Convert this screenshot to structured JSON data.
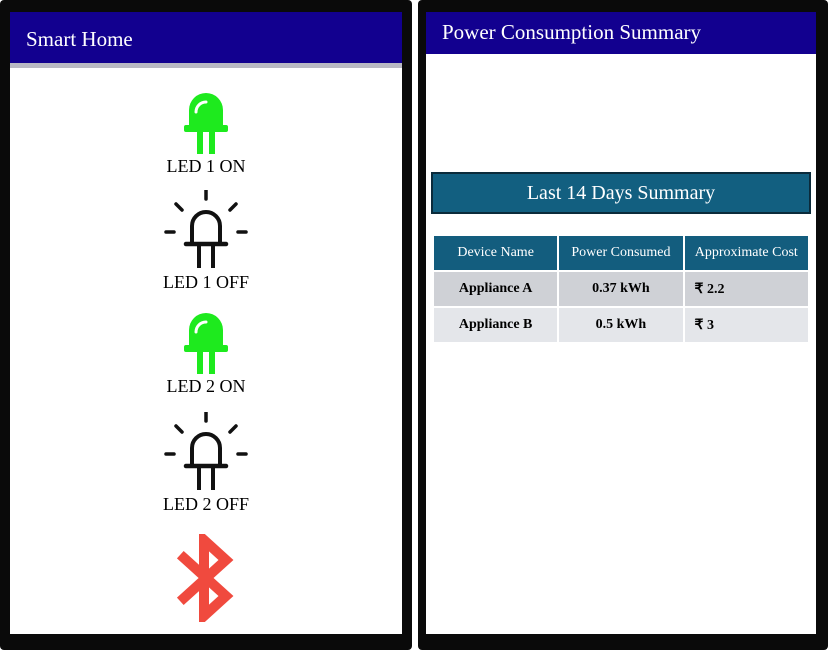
{
  "left_screen": {
    "title": "Smart Home",
    "leds": [
      {
        "label": "LED 1 ON",
        "state": "on"
      },
      {
        "label": "LED 1 OFF",
        "state": "off"
      },
      {
        "label": "LED 2 ON",
        "state": "on"
      },
      {
        "label": "LED 2 OFF",
        "state": "off"
      }
    ],
    "bluetooth_icon": "bluetooth-icon"
  },
  "right_screen": {
    "title": "Power Consumption Summary",
    "summary_header": "Last 14 Days Summary",
    "table": {
      "columns": [
        "Device Name",
        "Power Consumed",
        "Approximate Cost"
      ],
      "rows": [
        {
          "device": "Appliance A",
          "power": "0.37 kWh",
          "cost": "₹  2.2"
        },
        {
          "device": "Appliance B",
          "power": "0.5 kWh",
          "cost": "₹  3"
        }
      ]
    }
  },
  "colors": {
    "appbar": "#12008f",
    "led_on": "#1eea1e",
    "led_off": "#111111",
    "bluetooth": "#f04a3e",
    "table_header": "#135d7e"
  }
}
